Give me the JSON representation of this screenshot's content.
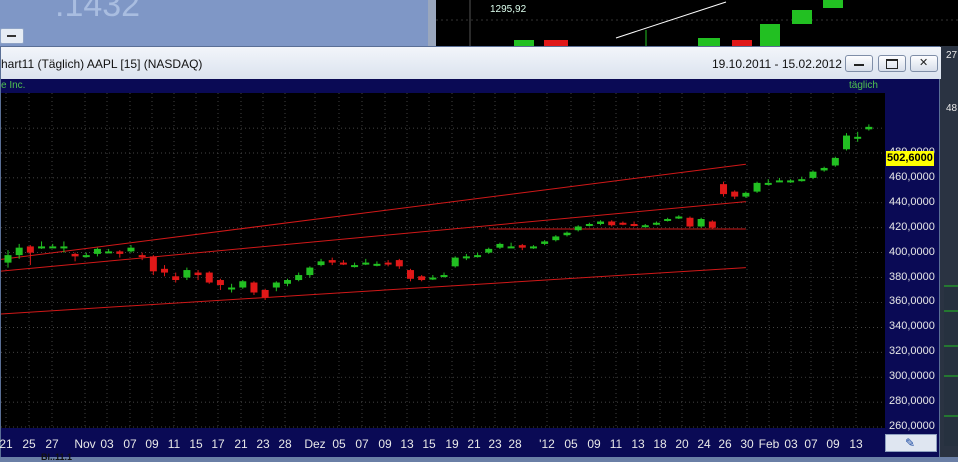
{
  "background": {
    "left_window_text": ".1432",
    "right_window_price": "1295,92",
    "right_edge_marks": [
      "27",
      "48"
    ]
  },
  "window": {
    "title": "hart11 (Täglich)  AAPL [15] (NASDAQ)",
    "date_range": "19.10.2011 - 15.02.2012",
    "buttons": {
      "minimize": "minimize",
      "maximize": "maximize",
      "close": "close"
    }
  },
  "chart_header": {
    "stock_name": "e Inc.",
    "period": "täglich"
  },
  "bottom_tab": "Bl..11.1",
  "icons": {
    "minimize": "minimize-icon",
    "maximize": "maximize-icon",
    "close": "close-icon",
    "draw_tool": "pencil-icon"
  },
  "colors": {
    "up": "#22c022",
    "down": "#e01818",
    "trend_line": "#d01818",
    "grid": "#5a5a5a",
    "price_marker": "#ffff00"
  },
  "chart_data": {
    "type": "candlestick",
    "title": "AAPL [15] (NASDAQ)",
    "last_price": "502,6000",
    "ylim": [
      246,
      512
    ],
    "y_ticks": [
      "480,0000",
      "460,0000",
      "440,0000",
      "420,0000",
      "400,0000",
      "380,0000",
      "360,0000",
      "340,0000",
      "320,0000",
      "300,0000",
      "280,0000",
      "260,0000"
    ],
    "x_ticks": [
      "21",
      "25",
      "27",
      "Nov",
      "03",
      "07",
      "09",
      "11",
      "15",
      "17",
      "21",
      "23",
      "28",
      "Dez",
      "05",
      "07",
      "09",
      "13",
      "15",
      "19",
      "21",
      "23",
      "28",
      "'12",
      "05",
      "09",
      "11",
      "13",
      "18",
      "20",
      "24",
      "26",
      "30",
      "Feb",
      "03",
      "07",
      "09",
      "13"
    ],
    "trend_lines": [
      {
        "start_index": -2,
        "start": 393,
        "end_index": 66,
        "end": 471
      },
      {
        "start_index": -2,
        "start": 350,
        "end_index": 66,
        "end": 388
      },
      {
        "start_index": -2,
        "start": 384,
        "end_index": 66,
        "end": 441
      },
      {
        "start_index": 43,
        "start": 419,
        "end_index": 66,
        "end": 419
      }
    ],
    "candles": [
      {
        "o": 392,
        "c": 398,
        "h": 402,
        "l": 388
      },
      {
        "o": 398,
        "c": 404,
        "h": 407,
        "l": 395
      },
      {
        "o": 405,
        "c": 400,
        "h": 406,
        "l": 390
      },
      {
        "o": 404,
        "c": 405,
        "h": 409,
        "l": 403
      },
      {
        "o": 405,
        "c": 405,
        "h": 407,
        "l": 404
      },
      {
        "o": 404,
        "c": 405,
        "h": 409,
        "l": 400
      },
      {
        "o": 399,
        "c": 397,
        "h": 400,
        "l": 393
      },
      {
        "o": 398,
        "c": 398,
        "h": 400,
        "l": 396
      },
      {
        "o": 399,
        "c": 403,
        "h": 404,
        "l": 397
      },
      {
        "o": 401,
        "c": 401,
        "h": 403,
        "l": 400
      },
      {
        "o": 401,
        "c": 399,
        "h": 402,
        "l": 396
      },
      {
        "o": 401,
        "c": 404,
        "h": 406,
        "l": 400
      },
      {
        "o": 398,
        "c": 397,
        "h": 400,
        "l": 394
      },
      {
        "o": 397,
        "c": 385,
        "h": 398,
        "l": 382
      },
      {
        "o": 387,
        "c": 384,
        "h": 390,
        "l": 381
      },
      {
        "o": 381,
        "c": 378,
        "h": 384,
        "l": 376
      },
      {
        "o": 380,
        "c": 386,
        "h": 388,
        "l": 378
      },
      {
        "o": 384,
        "c": 382,
        "h": 386,
        "l": 378
      },
      {
        "o": 384,
        "c": 376,
        "h": 385,
        "l": 375
      },
      {
        "o": 378,
        "c": 374,
        "h": 379,
        "l": 370
      },
      {
        "o": 372,
        "c": 372,
        "h": 375,
        "l": 368
      },
      {
        "o": 372,
        "c": 377,
        "h": 378,
        "l": 371
      },
      {
        "o": 376,
        "c": 368,
        "h": 377,
        "l": 366
      },
      {
        "o": 370,
        "c": 364,
        "h": 371,
        "l": 362
      },
      {
        "o": 372,
        "c": 376,
        "h": 377,
        "l": 369
      },
      {
        "o": 375,
        "c": 378,
        "h": 379,
        "l": 373
      },
      {
        "o": 378,
        "c": 382,
        "h": 384,
        "l": 377
      },
      {
        "o": 382,
        "c": 388,
        "h": 389,
        "l": 380
      },
      {
        "o": 390,
        "c": 393,
        "h": 395,
        "l": 389
      },
      {
        "o": 394,
        "c": 392,
        "h": 396,
        "l": 390
      },
      {
        "o": 392,
        "c": 391,
        "h": 394,
        "l": 390
      },
      {
        "o": 390,
        "c": 390,
        "h": 392,
        "l": 388
      },
      {
        "o": 392,
        "c": 392,
        "h": 395,
        "l": 390
      },
      {
        "o": 391,
        "c": 391,
        "h": 393,
        "l": 389
      },
      {
        "o": 392,
        "c": 391,
        "h": 394,
        "l": 389
      },
      {
        "o": 394,
        "c": 389,
        "h": 395,
        "l": 387
      },
      {
        "o": 386,
        "c": 379,
        "h": 387,
        "l": 377
      },
      {
        "o": 381,
        "c": 378,
        "h": 382,
        "l": 377
      },
      {
        "o": 379,
        "c": 380,
        "h": 382,
        "l": 378
      },
      {
        "o": 381,
        "c": 382,
        "h": 384,
        "l": 380
      },
      {
        "o": 389,
        "c": 396,
        "h": 397,
        "l": 388
      },
      {
        "o": 396,
        "c": 397,
        "h": 399,
        "l": 394
      },
      {
        "o": 397,
        "c": 398,
        "h": 400,
        "l": 396
      },
      {
        "o": 400,
        "c": 403,
        "h": 404,
        "l": 399
      },
      {
        "o": 404,
        "c": 407,
        "h": 408,
        "l": 403
      },
      {
        "o": 405,
        "c": 405,
        "h": 408,
        "l": 404
      },
      {
        "o": 406,
        "c": 404,
        "h": 407,
        "l": 402
      },
      {
        "o": 405,
        "c": 405,
        "h": 406,
        "l": 403
      },
      {
        "o": 407,
        "c": 409,
        "h": 410,
        "l": 406
      },
      {
        "o": 410,
        "c": 413,
        "h": 414,
        "l": 409
      },
      {
        "o": 414,
        "c": 416,
        "h": 417,
        "l": 413
      },
      {
        "o": 418,
        "c": 421,
        "h": 422,
        "l": 417
      },
      {
        "o": 422,
        "c": 423,
        "h": 424,
        "l": 421
      },
      {
        "o": 423,
        "c": 425,
        "h": 426,
        "l": 422
      },
      {
        "o": 425,
        "c": 422,
        "h": 426,
        "l": 421
      },
      {
        "o": 424,
        "c": 423,
        "h": 425,
        "l": 422
      },
      {
        "o": 423,
        "c": 422,
        "h": 425,
        "l": 421
      },
      {
        "o": 422,
        "c": 422,
        "h": 423,
        "l": 421
      },
      {
        "o": 423,
        "c": 424,
        "h": 425,
        "l": 422
      },
      {
        "o": 426,
        "c": 427,
        "h": 428,
        "l": 425
      },
      {
        "o": 428,
        "c": 429,
        "h": 430,
        "l": 427
      },
      {
        "o": 428,
        "c": 421,
        "h": 429,
        "l": 420
      },
      {
        "o": 421,
        "c": 427,
        "h": 428,
        "l": 420
      },
      {
        "o": 425,
        "c": 420,
        "h": 426,
        "l": 419
      },
      {
        "o": 455,
        "c": 447,
        "h": 457,
        "l": 445
      },
      {
        "o": 449,
        "c": 445,
        "h": 450,
        "l": 443
      },
      {
        "o": 445,
        "c": 448,
        "h": 449,
        "l": 444
      },
      {
        "o": 449,
        "c": 456,
        "h": 457,
        "l": 448
      },
      {
        "o": 455,
        "c": 456,
        "h": 459,
        "l": 454
      },
      {
        "o": 458,
        "c": 458,
        "h": 460,
        "l": 457
      },
      {
        "o": 458,
        "c": 458,
        "h": 459,
        "l": 456
      },
      {
        "o": 458,
        "c": 459,
        "h": 461,
        "l": 457
      },
      {
        "o": 460,
        "c": 465,
        "h": 466,
        "l": 459
      },
      {
        "o": 466,
        "c": 468,
        "h": 469,
        "l": 465
      },
      {
        "o": 470,
        "c": 476,
        "h": 477,
        "l": 469
      },
      {
        "o": 483,
        "c": 494,
        "h": 496,
        "l": 482
      },
      {
        "o": 493,
        "c": 493,
        "h": 497,
        "l": 489
      },
      {
        "o": 499,
        "c": 501,
        "h": 503,
        "l": 498
      }
    ]
  }
}
